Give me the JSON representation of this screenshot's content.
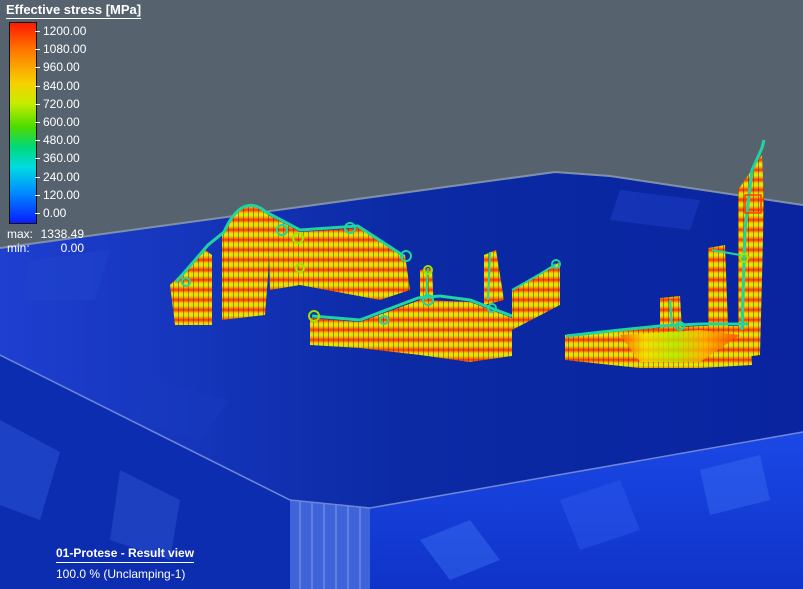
{
  "legend": {
    "title": "Effective stress [MPa]",
    "ticks": [
      "1200.00",
      "1080.00",
      "960.00",
      "840.00",
      "720.00",
      "600.00",
      "480.00",
      "360.00",
      "240.00",
      "120.00",
      "0.00"
    ],
    "max_label": "max:",
    "max_value": "1338.49",
    "min_label": "min:",
    "min_value": "0.00",
    "colors": [
      "#ff1a00",
      "#ff7a00",
      "#f7d000",
      "#c8ec00",
      "#4ddc00",
      "#00d878",
      "#00dce0",
      "#0090ff",
      "#0a1cff"
    ]
  },
  "view": {
    "title": "01-Protese - Result view",
    "subtitle": "100.0 % (Unclamping-1)"
  },
  "scene": {
    "background_color": "#56636f",
    "plate_color": "#0b2ea8"
  }
}
